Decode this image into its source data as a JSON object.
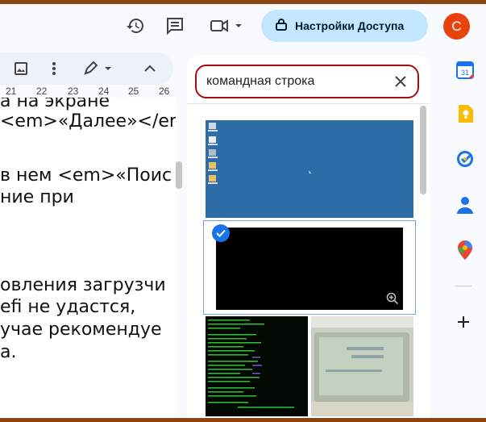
{
  "header": {
    "history_icon": "history-icon",
    "comments_icon": "comment-icon",
    "meet_icon": "video-camera-icon",
    "share_label": "Настройки Доступа",
    "avatar_letter": "С"
  },
  "ruler": {
    "ticks": [
      "21",
      "22",
      "23",
      "24",
      "25",
      "26"
    ]
  },
  "document": {
    "lines": [
      "а на экране",
      "<em>«Далее»</em",
      "в нем <em>«Поис",
      "ние при",
      "овления загрузчи",
      "efi не удастся,",
      "учае рекомендуе",
      "а."
    ]
  },
  "image_search": {
    "query": "командная строка",
    "results": [
      {
        "name": "desktop-screenshot"
      },
      {
        "name": "command-prompt-window",
        "selected": true
      },
      {
        "name": "green-console-text"
      },
      {
        "name": "old-monitor-photo"
      }
    ]
  },
  "colors": {
    "share_bg": "#c2e7ff",
    "avatar_bg": "#e8430f",
    "search_border": "#a50e0e",
    "select_blue": "#1a73e8",
    "frame": "#8b4513"
  },
  "side_apps": [
    "calendar-icon",
    "keep-icon",
    "tasks-icon",
    "contacts-icon",
    "maps-icon",
    "add-icon"
  ],
  "calendar_day": "31"
}
